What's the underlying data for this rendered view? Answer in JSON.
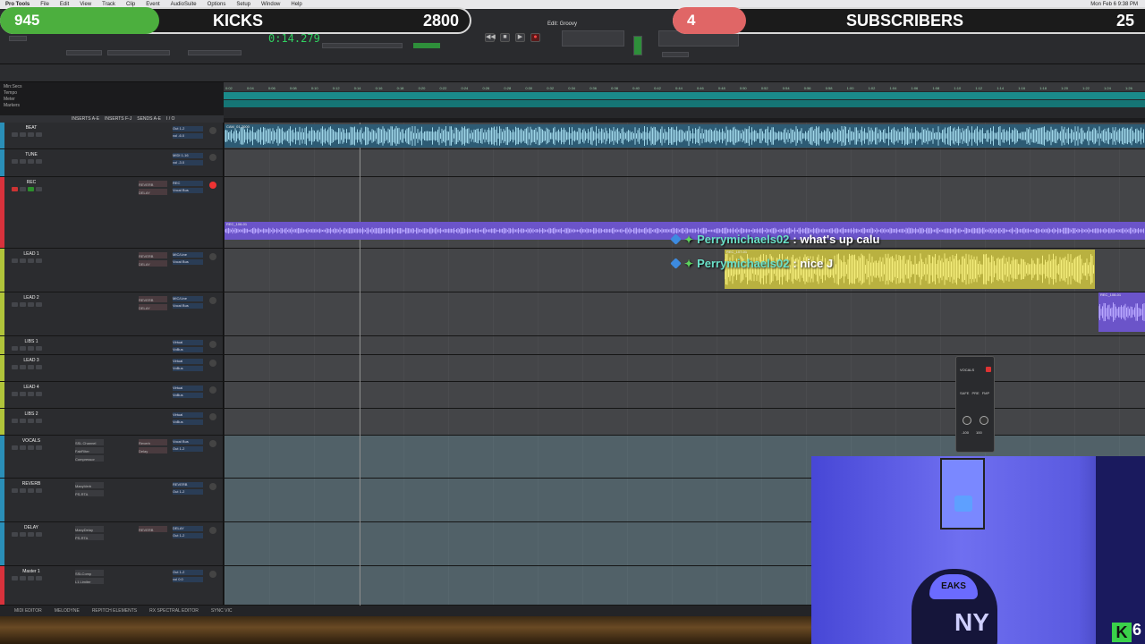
{
  "menubar": {
    "app": "Pro Tools",
    "items": [
      "File",
      "Edit",
      "View",
      "Track",
      "Clip",
      "Event",
      "AudioSuite",
      "Options",
      "Setup",
      "Window",
      "Help"
    ],
    "clock": "Mon Feb 6 9:38 PM"
  },
  "overlay": {
    "kicks_count": "945",
    "kicks_label": "KICKS",
    "kicks_goal": "2800",
    "subs_count": "4",
    "subs_label": "SUBSCRIBERS",
    "subs_goal": "25",
    "accent_green": "#4caf3e",
    "accent_red": "#e06666"
  },
  "transport": {
    "window_title": "Edit: Groovy",
    "counter": "0:14.279",
    "buttons": [
      "rewind-icon",
      "stop-icon",
      "play-icon",
      "record-icon"
    ]
  },
  "ruler": {
    "labels": [
      "Min:Secs",
      "Tempo",
      "Meter",
      "Markers"
    ],
    "ticks": [
      "0:02",
      "0:04",
      "0:06",
      "0:08",
      "0:10",
      "0:12",
      "0:14",
      "0:16",
      "0:18",
      "0:20",
      "0:22",
      "0:24",
      "0:26",
      "0:28",
      "0:30",
      "0:32",
      "0:34",
      "0:36",
      "0:38",
      "0:40",
      "0:42",
      "0:44",
      "0:46",
      "0:48",
      "0:50",
      "0:52",
      "0:54",
      "0:56",
      "0:58",
      "1:00",
      "1:02",
      "1:04",
      "1:06",
      "1:08",
      "1:10",
      "1:12",
      "1:14",
      "1:16",
      "1:18",
      "1:20",
      "1:22",
      "1:24",
      "1:26"
    ]
  },
  "mix_columns": [
    "INSERTS A-E",
    "INSERTS F-J",
    "SENDS A-E",
    "I / O"
  ],
  "tracks": [
    {
      "name": "BEAT",
      "color": "#2a8fb8",
      "sends": [],
      "io": [
        "Out 1-2",
        "vol -6.0"
      ]
    },
    {
      "name": "TUNE",
      "color": "#2a8fb8",
      "sends": [],
      "io": [
        "MIDI 1-16",
        "vol -3.0"
      ]
    },
    {
      "name": "REC",
      "color": "#d8323c",
      "sends": [
        "REVERB",
        "DELAY"
      ],
      "io": [
        "REC",
        "Vocal Bus"
      ],
      "clip": "REC_106-01"
    },
    {
      "name": "LEAD 1",
      "color": "#b0c43a",
      "sends": [
        "REVERB",
        "DELAY"
      ],
      "io": [
        "MIC/Line",
        "Vocal Bus"
      ]
    },
    {
      "name": "LEAD 2",
      "color": "#b0c43a",
      "sends": [
        "REVERB",
        "DELAY"
      ],
      "io": [
        "MIC/Line",
        "Vocal Bus"
      ]
    },
    {
      "name": "LIBS 1",
      "color": "#b0c43a",
      "sends": [],
      "io": [
        "Virtual",
        "VoBus"
      ]
    },
    {
      "name": "LEAD 3",
      "color": "#b0c43a",
      "sends": [],
      "io": [
        "Virtual",
        "VoBus"
      ]
    },
    {
      "name": "LEAD 4",
      "color": "#b0c43a",
      "sends": [],
      "io": [
        "Virtual",
        "VoBus"
      ]
    },
    {
      "name": "LIBS 2",
      "color": "#b0c43a",
      "sends": [],
      "io": [
        "Virtual",
        "VoBus"
      ]
    },
    {
      "name": "VOCALS",
      "color": "#2a8fb8",
      "sends": [
        "Reverb",
        "Delay"
      ],
      "io": [
        "Vocal Bus",
        "Out 1-2"
      ],
      "inserts": [
        "SSL Channel",
        "FabFilter",
        "Compressor"
      ]
    },
    {
      "name": "REVERB",
      "color": "#2a8fb8",
      "sends": [],
      "io": [
        "REVERB",
        "Out 1-2"
      ],
      "inserts": [
        "ManyVerb",
        "PS-RTA"
      ]
    },
    {
      "name": "DELAY",
      "color": "#2a8fb8",
      "sends": [
        "REVERB"
      ],
      "io": [
        "DELAY",
        "Out 1-2"
      ],
      "inserts": [
        "ManyDelay",
        "PS-RTA"
      ]
    },
    {
      "name": "Master 1",
      "color": "#d8323c",
      "sends": [],
      "io": [
        "Out 1-2",
        "vol 0.0"
      ],
      "inserts": [
        "SSLComp",
        "L1 Limiter"
      ]
    }
  ],
  "clips": {
    "beat": "CAM_01-2000",
    "rec": "REC_106-01",
    "yellow": "REC_107-01",
    "small": "REC_108-01"
  },
  "mini_plugin": {
    "title": "VOCALS",
    "labels": [
      "SAFE",
      "PRE",
      "FMP"
    ],
    "values": [
      "-100",
      "100"
    ]
  },
  "chat": [
    {
      "user": "Perrymichaels02",
      "message": ": what's up calu"
    },
    {
      "user": "Perrymichaels02",
      "message": ": nice J"
    }
  ],
  "bottom_tabs": [
    "MIDI EDITOR",
    "MELODYNE",
    "REPITCH ELEMENTS",
    "RX SPECTRAL EDITOR",
    "SYNC VIC"
  ],
  "webcam": {
    "cap_text": "EAKS",
    "kick_count": "6"
  }
}
